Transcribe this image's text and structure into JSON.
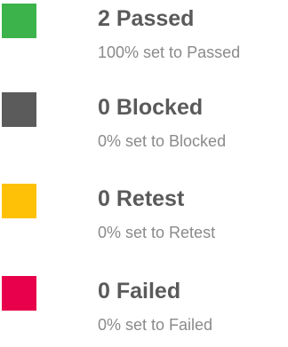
{
  "statuses": [
    {
      "count": "2",
      "label": "Passed",
      "summary": "100% set to Passed",
      "percent": 100,
      "color": "#3cb44b"
    },
    {
      "count": "0",
      "label": "Blocked",
      "summary": "0% set to Blocked",
      "percent": 0,
      "color": "#5b5b5b"
    },
    {
      "count": "0",
      "label": "Retest",
      "summary": "0% set to Retest",
      "percent": 0,
      "color": "#ffc107"
    },
    {
      "count": "0",
      "label": "Failed",
      "summary": "0% set to Failed",
      "percent": 0,
      "color": "#e8004c"
    }
  ]
}
